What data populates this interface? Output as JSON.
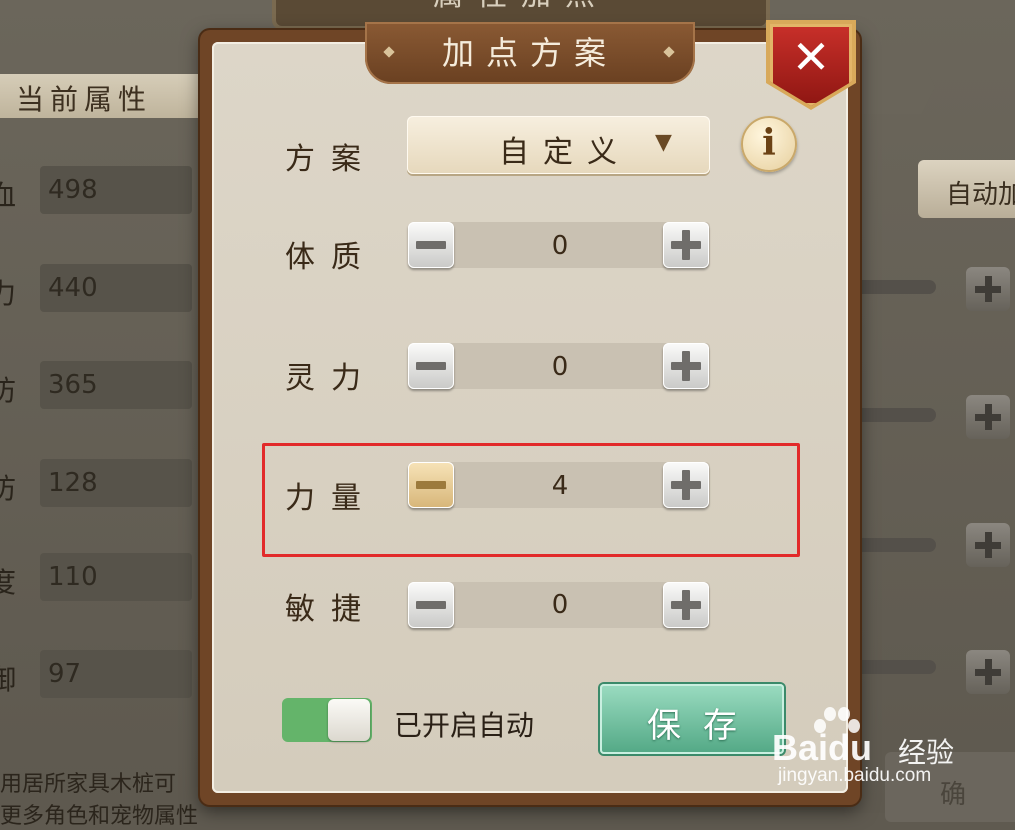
{
  "background": {
    "title": "属性加点",
    "tab_label": "当前属性",
    "stats": [
      {
        "char": "血",
        "value": "498"
      },
      {
        "char": "力",
        "value": "440"
      },
      {
        "char": "防",
        "value": "365"
      },
      {
        "char": "防",
        "value": "128"
      },
      {
        "char": "度",
        "value": "110"
      },
      {
        "char": "御",
        "value": "97"
      }
    ],
    "auto_button": "自动加",
    "notes": [
      "用居所家具木桩可",
      "更多角色和宠物属性"
    ],
    "corner_button": "确"
  },
  "dialog": {
    "title": "加点方案",
    "close_glyph": "✕",
    "scheme_label": "方案",
    "scheme_value": "自定义",
    "dropdown_arrow": "▼",
    "info_glyph": "i",
    "attributes": [
      {
        "label": "体质",
        "value": "0"
      },
      {
        "label": "灵力",
        "value": "0"
      },
      {
        "label": "力量",
        "value": "4"
      },
      {
        "label": "敏捷",
        "value": "0"
      }
    ],
    "auto_toggle": {
      "on": true,
      "label": "已开启自动"
    },
    "save_label": "保存"
  },
  "watermark": {
    "logo": "Baidu",
    "cn": "经验",
    "url": "jingyan.baidu.com"
  },
  "colors": {
    "frame": "#6f4526",
    "parchment": "#d8d0c1",
    "toggle_on": "#64b46a",
    "save": "#52a885",
    "highlight": "#e22a2a",
    "close": "#b8241f"
  }
}
